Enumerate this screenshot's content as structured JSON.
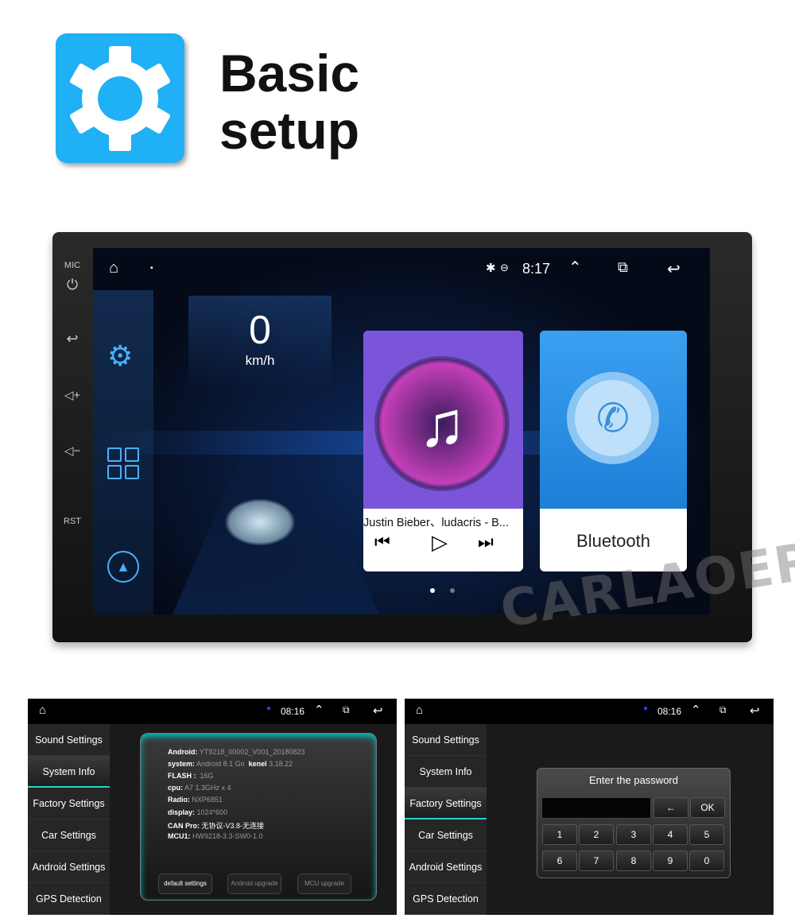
{
  "header": {
    "icon": "gear-icon",
    "title_line1": "Basic",
    "title_line2": "setup",
    "accent": "#1fb0f5"
  },
  "device": {
    "side_labels": {
      "mic": "MIC",
      "rst": "RST"
    },
    "status_bar": {
      "time": "8:17"
    },
    "speed": {
      "value": "0",
      "unit": "km/h"
    },
    "music_card": {
      "track": "Justin Bieber、ludacris - B...",
      "color": "#7b55d9"
    },
    "bluetooth_card": {
      "label": "Bluetooth",
      "color": "#2e8fe0"
    },
    "page_dots": {
      "count": 2,
      "active": 1
    }
  },
  "watermark": "CARLAOER",
  "panels": {
    "time": "08:16",
    "menu": [
      "Sound Settings",
      "System Info",
      "Factory Settings",
      "Car Settings",
      "Android Settings",
      "GPS Detection"
    ],
    "system_info": {
      "rows": [
        {
          "label": "Android:",
          "value": "YT9218_00002_V001_20180823"
        },
        {
          "label": "system:",
          "value": "Android 8.1 Go",
          "extra_label": "kenel",
          "extra_value": "3.18.22"
        },
        {
          "label": "FLASH :",
          "value": "16G"
        },
        {
          "label": "cpu:",
          "value": "A7 1.3GHz x 4"
        },
        {
          "label": "Radio:",
          "value": "NXP6851"
        },
        {
          "label": "display:",
          "value": "1024*600"
        },
        {
          "label": "CAN Pro:",
          "value": "无协议-V3.8-无连接"
        },
        {
          "label": "MCU1:",
          "value": "HW9218-3.3-SW0-1.0"
        }
      ],
      "buttons": [
        "default settings",
        "Android upgrade",
        "MCU upgrade"
      ]
    },
    "password": {
      "title": "Enter the password",
      "value": "",
      "backspace": "←",
      "ok": "OK",
      "keys": [
        "1",
        "2",
        "3",
        "4",
        "5",
        "6",
        "7",
        "8",
        "9",
        "0"
      ]
    }
  }
}
